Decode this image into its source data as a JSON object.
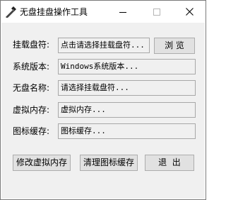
{
  "window": {
    "title": "无盘挂盘操作工具",
    "controls": {
      "minimize_icon": "minimize-icon",
      "maximize_icon": "maximize-icon",
      "close_icon": "close-icon"
    }
  },
  "form": {
    "mount_drive": {
      "label": "挂载盘符:",
      "value": "点击请选择挂载盘符...",
      "browse_label": "浏 览"
    },
    "system_version": {
      "label": "系统版本:",
      "value": "Windows系统版本..."
    },
    "diskless_name": {
      "label": "无盘名称:",
      "value": "请选择挂载盘符..."
    },
    "virtual_memory": {
      "label": "虚拟内存:",
      "value": "虚拟内存..."
    },
    "icon_cache": {
      "label": "图标缓存:",
      "value": "图标缓存..."
    }
  },
  "actions": {
    "modify_virtual_memory": "修改虚拟内存",
    "clear_icon_cache": "清理图标缓存",
    "exit": "退  出"
  }
}
